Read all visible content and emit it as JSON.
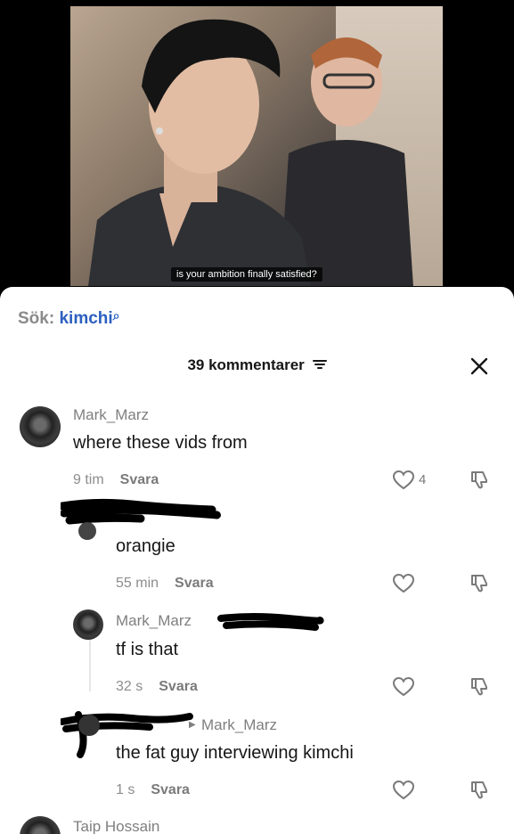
{
  "video": {
    "subtitle": "is your ambition finally satisfied?"
  },
  "search": {
    "prefix": "Sök:",
    "term": "kimchi",
    "icon": "search-icon"
  },
  "comments_header": {
    "title": "39 kommentarer",
    "filter_icon": "filter-icon",
    "close_icon": "close-icon"
  },
  "comments": [
    {
      "username": "Mark_Marz",
      "text": "where these vids from",
      "time": "9 tim",
      "reply_label": "Svara",
      "likes": "4"
    },
    {
      "username": "",
      "text": "orangie",
      "time": "55 min",
      "reply_label": "Svara",
      "likes": ""
    },
    {
      "username": "Mark_Marz",
      "text": "tf is that",
      "time": "32 s",
      "reply_label": "Svara",
      "likes": ""
    },
    {
      "username": "",
      "reply_to": "Mark_Marz",
      "text": "the fat guy interviewing kimchi",
      "time": "1 s",
      "reply_label": "Svara",
      "likes": ""
    },
    {
      "username": "Taip Hossain"
    }
  ]
}
